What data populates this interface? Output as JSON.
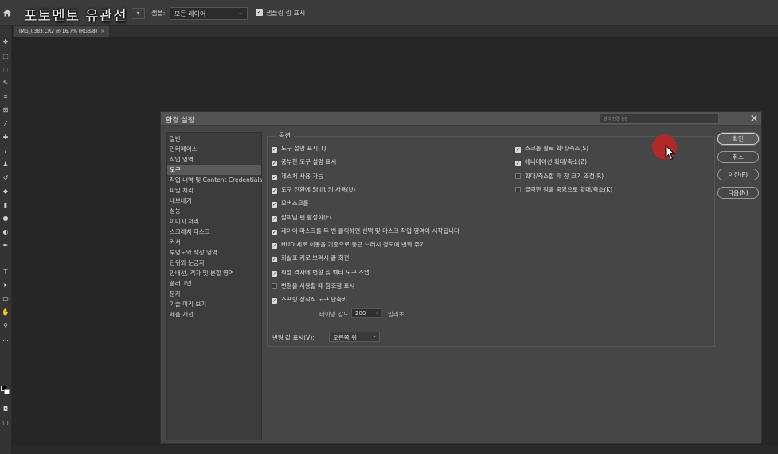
{
  "watermark": "포토멘토 유관선",
  "options_bar": {
    "sample_label": "샘플:",
    "sample_value": "모든 레이어",
    "sample_ring_checked": true,
    "sample_ring_label": "샘플링 링 표시"
  },
  "doc_tab": {
    "label": "IMG_0383.CR2 @ 16.7% (RGB/8)",
    "close": "×"
  },
  "dialog": {
    "title": "환경 설정",
    "search_placeholder": "검색 환경 설정",
    "close": "✕",
    "categories": [
      {
        "label": "일반",
        "selected": false
      },
      {
        "label": "인터페이스",
        "selected": false
      },
      {
        "label": "작업 영역",
        "selected": false
      },
      {
        "label": "도구",
        "selected": true
      },
      {
        "label": "작업 내역 및 Content Credentials",
        "selected": false
      },
      {
        "label": "파일 처리",
        "selected": false
      },
      {
        "label": "내보내기",
        "selected": false
      },
      {
        "label": "성능",
        "selected": false
      },
      {
        "label": "이미지 처리",
        "selected": false
      },
      {
        "label": "스크래치 디스크",
        "selected": false
      },
      {
        "label": "커서",
        "selected": false
      },
      {
        "label": "투명도와 색상 영역",
        "selected": false
      },
      {
        "label": "단위와 눈금자",
        "selected": false
      },
      {
        "label": "안내선, 격자 및 분할 영역",
        "selected": false
      },
      {
        "label": "플러그인",
        "selected": false
      },
      {
        "label": "문자",
        "selected": false
      },
      {
        "label": "기술 미리 보기",
        "selected": false
      },
      {
        "label": "제품 개선",
        "selected": false
      }
    ],
    "options_legend": "옵션",
    "left_options": [
      {
        "label": "도구 설명 표시(T)",
        "checked": true
      },
      {
        "label": "풍부한 도구 설명 표시",
        "checked": true
      },
      {
        "label": "제스처 사용 가능",
        "checked": true
      },
      {
        "label": "도구 전환에 Shift 키 사용(U)",
        "checked": true
      },
      {
        "label": "오버스크롤",
        "checked": true
      },
      {
        "label": "깜박임 팬 활성화(F)",
        "checked": true
      },
      {
        "label": "레이어 마스크를 두 번 클릭하면 선택 및 마스크 작업 영역이 시작됩니다",
        "checked": true
      },
      {
        "label": "HUD 세로 이동을 기준으로 둥근 브러시 경도에 변화 주기",
        "checked": true
      },
      {
        "label": "화살표 키로 브러시 끝 회전",
        "checked": true
      },
      {
        "label": "픽셀 격자에 변형 및 벡터 도구 스냅",
        "checked": true
      },
      {
        "label": "변형을 사용할 때 참조점 표시",
        "checked": false
      },
      {
        "label": "스프링 장착식 도구 단축키",
        "checked": true
      }
    ],
    "right_options": [
      {
        "label": "스크롤 휠로 확대/축소(S)",
        "checked": true
      },
      {
        "label": "애니메이션 확대/축소(Z)",
        "checked": true
      },
      {
        "label": "확대/축소할 때 창 크기 조정(R)",
        "checked": false
      },
      {
        "label": "클릭한 점을 중앙으로 확대/축소(K)",
        "checked": false
      }
    ],
    "tilt": {
      "label": "타이밍 강도:",
      "value": "200",
      "unit": "밀리초"
    },
    "transform_label": "변형 값 표시(V):",
    "transform_value": "오른쪽 위",
    "buttons": {
      "ok": "확인",
      "cancel": "취소",
      "prev": "이전(P)",
      "next": "다음(N)"
    }
  }
}
